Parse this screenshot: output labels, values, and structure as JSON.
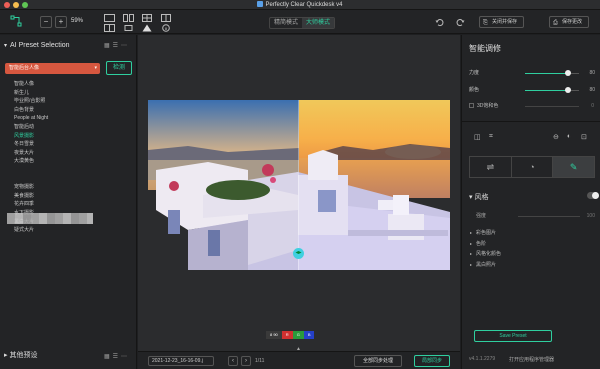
{
  "window": {
    "title": "Perfectly Clear Quickdesk v4",
    "traffic_colors": [
      "#ee5f57",
      "#f5bd4f",
      "#5fc554"
    ]
  },
  "toolbar": {
    "zoom_minus": "−",
    "zoom_plus": "+",
    "zoom_value": "59%",
    "mode_precise": "精简模式",
    "mode_master": "大师模式",
    "close_save": "关闭并保存",
    "save_changes": "保存更改"
  },
  "left_panel": {
    "title": "AI Preset Selection",
    "selected_preset": "智能后台人像",
    "detect_button": "检测",
    "presets": [
      "智能人像",
      "新生儿",
      "毕业照/合影照",
      "白色背景",
      "People at Night",
      "智能后动",
      "风景摄影",
      "冬日雪景",
      "夜景大片",
      "大漠黄色",
      "",
      "",
      "宠物摄影",
      "美食摄影",
      "花卉四季",
      "水下摄影",
      "黑白大片",
      "疑式大片"
    ],
    "active_index": 6,
    "other_presets": "其他预设"
  },
  "center": {
    "histogram": [
      {
        "label": "8 90",
        "color": "#3a3a3a"
      },
      {
        "label": "R",
        "color": "#d03030"
      },
      {
        "label": "G",
        "color": "#2a9a3a"
      },
      {
        "label": "B",
        "color": "#2540c8"
      }
    ],
    "date_select": "2021-12-23_16-16-09.j",
    "page": "1/11",
    "sync_all": "全部同步处理",
    "sync": "局部同步"
  },
  "right_panel": {
    "title": "智能调修",
    "sliders": [
      {
        "label": "力度",
        "value": 80,
        "display": "80"
      },
      {
        "label": "颜色",
        "value": 80,
        "display": "80"
      }
    ],
    "checkbox_3d": "3D饱和色",
    "checkbox_val": "0",
    "style_title": "风格",
    "strength_label": "强度",
    "strength_value": "100",
    "style_items": [
      "彩色图片",
      "色阶",
      "风格化颜色",
      "黑白照片"
    ],
    "save_preset": "Save Preset",
    "version": "v4.1.1.2279",
    "manager": "打开应用程序管理器"
  },
  "colors": {
    "accent": "#2fcf9f",
    "preset_highlight": "#d6573f"
  }
}
